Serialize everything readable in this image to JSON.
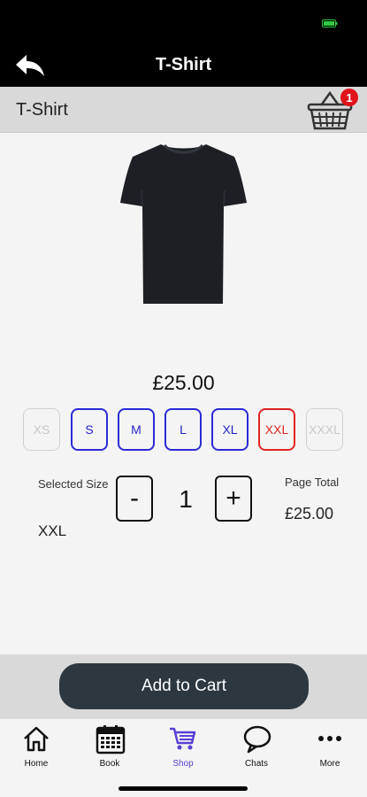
{
  "nav": {
    "title": "T-Shirt",
    "back_icon": "back-arrow-icon"
  },
  "header": {
    "title": "T-Shirt",
    "cart_icon": "shopping-basket-icon",
    "cart_count": "1"
  },
  "product": {
    "image": "black-tshirt-image",
    "price": "£25.00",
    "sizes": [
      {
        "label": "XS",
        "state": "disabled"
      },
      {
        "label": "S",
        "state": "available"
      },
      {
        "label": "M",
        "state": "available"
      },
      {
        "label": "L",
        "state": "available"
      },
      {
        "label": "XL",
        "state": "available"
      },
      {
        "label": "XXL",
        "state": "selected"
      },
      {
        "label": "XXXL",
        "state": "disabled"
      }
    ]
  },
  "selection": {
    "size_label": "Selected Size",
    "size_value": "XXL",
    "quantity": "1",
    "minus_label": "-",
    "plus_label": "+",
    "total_label": "Page Total",
    "total_value": "£25.00"
  },
  "actions": {
    "add_to_cart": "Add to Cart"
  },
  "tabs": [
    {
      "label": "Home",
      "icon": "home-icon"
    },
    {
      "label": "Book",
      "icon": "calendar-icon"
    },
    {
      "label": "Shop",
      "icon": "shopping-cart-icon",
      "active": true
    },
    {
      "label": "Chats",
      "icon": "chat-bubble-icon"
    },
    {
      "label": "More",
      "icon": "more-dots-icon"
    }
  ],
  "colors": {
    "size_available": "#2a2ad6",
    "size_selected": "#e02222",
    "size_disabled": "#cfcfcf",
    "tab_active": "#5a3fd6",
    "add_button": "#2d3740",
    "badge": "#e0131b"
  }
}
